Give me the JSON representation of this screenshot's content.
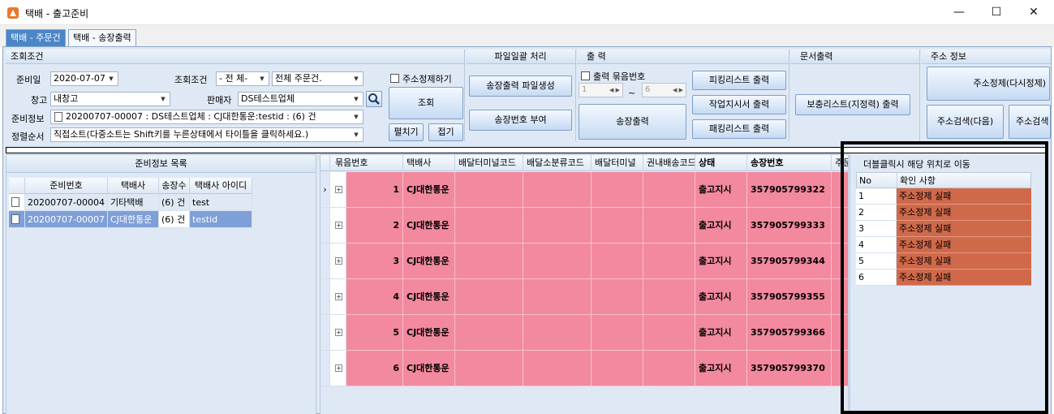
{
  "window": {
    "title": "택배 - 출고준비",
    "minimize": "—",
    "maximize": "☐",
    "close": "✕"
  },
  "tabs": [
    {
      "label": "택배 - 주문건",
      "active": false
    },
    {
      "label": "택배 - 송장출력",
      "active": true
    }
  ],
  "search": {
    "header": "조회조건",
    "date_label": "준비일",
    "date_value": "2020-07-07",
    "cond_label": "조회조건",
    "cond_value": "- 전  체-",
    "cond_value2": "전체 주문건.",
    "addr_check_label": "주소정제하기",
    "warehouse_label": "창고",
    "warehouse_value": "내창고",
    "seller_label": "판매자",
    "seller_value": "DS테스트업체",
    "prep_label": "준비정보",
    "prep_value": "20200707-00007 : DS테스트업체 : CJ대한통운:testid : (6) 건",
    "sort_label": "정렬순서",
    "sort_value": "직접소트(다중소트는 Shift키를 누른상태에서 타이틀을 클릭하세요.)",
    "search_button": "조회",
    "expand_button": "펼치기",
    "collapse_button": "접기"
  },
  "file_group": {
    "header": "파일일괄 처리",
    "generate_button": "송장출력 파일생성",
    "assign_button": "송장번호 부여"
  },
  "print_group": {
    "header": "출  력",
    "bundle_check_label": "출력 묶음번호",
    "from_value": "1",
    "tilde": "~",
    "to_value": "6",
    "print_button": "송장출력",
    "picking_button": "피킹리스트 출력",
    "work_button": "작업지시서 출력",
    "packing_button": "패킹리스트 출력"
  },
  "doc_group": {
    "header": "문서출력",
    "supplement_button": "보충리스트(지정력) 출력"
  },
  "addr_group": {
    "header": "주소 정보",
    "refine_button": "주소정제(다시정제)",
    "search_next_button": "주소검색(다음)",
    "search_button": "주소검색"
  },
  "prep_list": {
    "title": "준비정보 목록",
    "columns": [
      "준비번호",
      "택배사",
      "송장수",
      "택배사 아이디"
    ],
    "rows": [
      {
        "id": "20200707-00004",
        "carrier": "기타택배",
        "count": "(6) 건",
        "account": "test",
        "selected": false
      },
      {
        "id": "20200707-00007",
        "carrier": "CJ대한통운",
        "count": "(6) 건",
        "account": "testid",
        "selected": true
      }
    ]
  },
  "shipments": {
    "columns": [
      "묶음번호",
      "택배사",
      "배달터미널코드",
      "배달소분류코드",
      "배달터미널",
      "권내배송코드",
      "상태",
      "송장번호",
      "주문"
    ],
    "rows": [
      {
        "bundle": "1",
        "carrier": "CJ대한통운",
        "status": "출고지시",
        "invoice": "357905799322",
        "current": true
      },
      {
        "bundle": "2",
        "carrier": "CJ대한통운",
        "status": "출고지시",
        "invoice": "357905799333",
        "current": false
      },
      {
        "bundle": "3",
        "carrier": "CJ대한통운",
        "status": "출고지시",
        "invoice": "357905799344",
        "current": false
      },
      {
        "bundle": "4",
        "carrier": "CJ대한통운",
        "status": "출고지시",
        "invoice": "357905799355",
        "current": false
      },
      {
        "bundle": "5",
        "carrier": "CJ대한통운",
        "status": "출고지시",
        "invoice": "357905799366",
        "current": false
      },
      {
        "bundle": "6",
        "carrier": "CJ대한통운",
        "status": "출고지시",
        "invoice": "357905799370",
        "current": false
      }
    ]
  },
  "check_panel": {
    "title": "더블클릭시 해당 위치로 이동",
    "columns": [
      "No",
      "확인 사항"
    ],
    "rows": [
      {
        "no": "1",
        "msg": "주소정제 실패"
      },
      {
        "no": "2",
        "msg": "주소정제 실패"
      },
      {
        "no": "3",
        "msg": "주소정제 실패"
      },
      {
        "no": "4",
        "msg": "주소정제 실패"
      },
      {
        "no": "5",
        "msg": "주소정제 실패"
      },
      {
        "no": "6",
        "msg": "주소정제 실패"
      }
    ]
  },
  "colors": {
    "row_pink": "#f2899e",
    "error_orange": "#d0694a",
    "selected_blue": "#7f9fd8",
    "tab_blue": "#4a86c8"
  }
}
